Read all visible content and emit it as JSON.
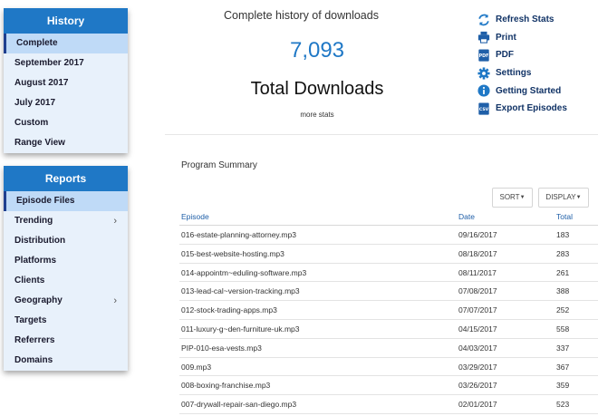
{
  "history": {
    "title": "History",
    "items": [
      {
        "label": "Complete"
      },
      {
        "label": "September 2017"
      },
      {
        "label": "August 2017"
      },
      {
        "label": "July 2017"
      },
      {
        "label": "Custom"
      },
      {
        "label": "Range View"
      }
    ]
  },
  "reports": {
    "title": "Reports",
    "items": [
      {
        "label": "Episode Files"
      },
      {
        "label": "Trending",
        "chevron": "›"
      },
      {
        "label": "Distribution"
      },
      {
        "label": "Platforms"
      },
      {
        "label": "Clients"
      },
      {
        "label": "Geography",
        "chevron": "›"
      },
      {
        "label": "Targets"
      },
      {
        "label": "Referrers"
      },
      {
        "label": "Domains"
      }
    ]
  },
  "summary": {
    "caption": "Complete history of downloads",
    "total": "7,093",
    "label": "Total Downloads",
    "more_stats": "more stats"
  },
  "actions": [
    {
      "label": "Refresh Stats",
      "icon": "refresh-icon"
    },
    {
      "label": "Print",
      "icon": "print-icon"
    },
    {
      "label": "PDF",
      "icon": "pdf-icon"
    },
    {
      "label": "Settings",
      "icon": "gear-icon"
    },
    {
      "label": "Getting Started",
      "icon": "info-icon"
    },
    {
      "label": "Export Episodes",
      "icon": "csv-icon"
    }
  ],
  "program_summary": {
    "title": "Program Summary",
    "sort_label": "SORT",
    "display_label": "DISPLAY",
    "columns": {
      "episode": "Episode",
      "date": "Date",
      "total": "Total"
    },
    "rows": [
      {
        "episode": "016-estate-planning-attorney.mp3",
        "date": "09/16/2017",
        "total": "183"
      },
      {
        "episode": "015-best-website-hosting.mp3",
        "date": "08/18/2017",
        "total": "283"
      },
      {
        "episode": "014-appointm~eduling-software.mp3",
        "date": "08/11/2017",
        "total": "261"
      },
      {
        "episode": "013-lead-cal~version-tracking.mp3",
        "date": "07/08/2017",
        "total": "388"
      },
      {
        "episode": "012-stock-trading-apps.mp3",
        "date": "07/07/2017",
        "total": "252"
      },
      {
        "episode": "011-luxury-g~den-furniture-uk.mp3",
        "date": "04/15/2017",
        "total": "558"
      },
      {
        "episode": "PIP-010-esa-vests.mp3",
        "date": "04/03/2017",
        "total": "337"
      },
      {
        "episode": "009.mp3",
        "date": "03/29/2017",
        "total": "367"
      },
      {
        "episode": "008-boxing-franchise.mp3",
        "date": "03/26/2017",
        "total": "359"
      },
      {
        "episode": "007-drywall-repair-san-diego.mp3",
        "date": "02/01/2017",
        "total": "523"
      }
    ]
  },
  "colors": {
    "accent": "#1f78c6",
    "panel_bg": "#e8f1fb",
    "active_item": "#bfdaf7",
    "action_text": "#113366"
  }
}
